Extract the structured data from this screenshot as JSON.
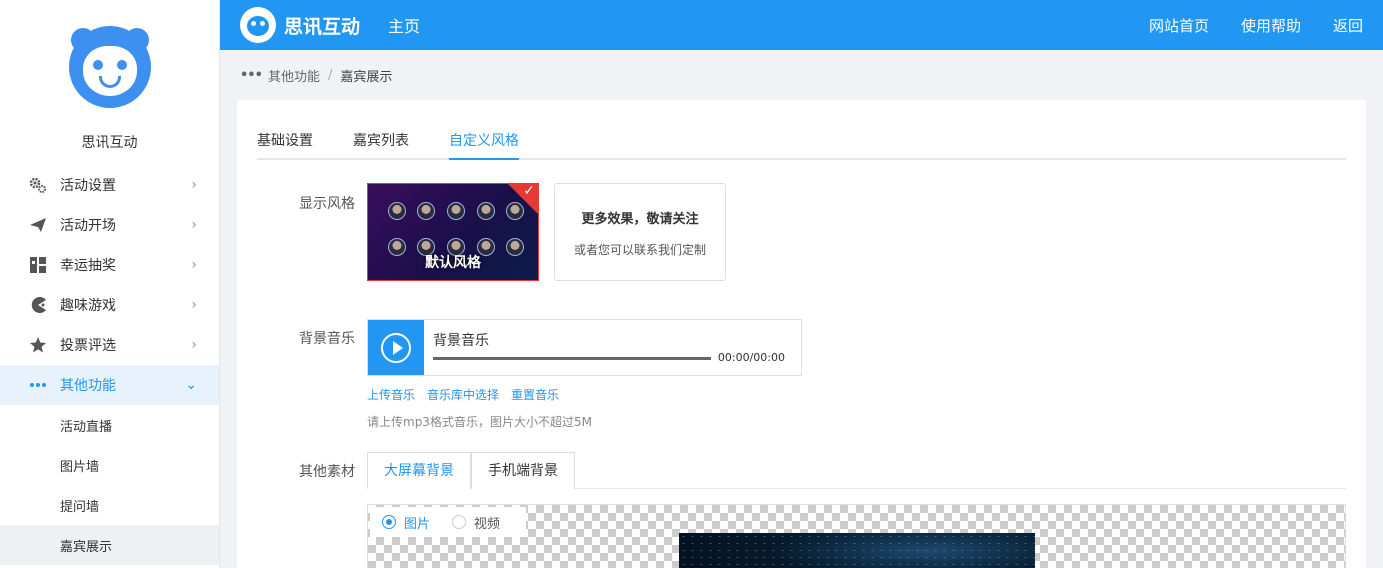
{
  "brand": {
    "name": "思讯互动"
  },
  "topbar": {
    "brand": "思讯互动",
    "home": "主页",
    "links": [
      "网站首页",
      "使用帮助",
      "返回"
    ]
  },
  "sidebar": {
    "items": [
      {
        "label": "活动设置",
        "icon": "gears-icon"
      },
      {
        "label": "活动开场",
        "icon": "paper-plane-icon"
      },
      {
        "label": "幸运抽奖",
        "icon": "grid-icon"
      },
      {
        "label": "趣味游戏",
        "icon": "pacman-icon"
      },
      {
        "label": "投票评选",
        "icon": "star-icon"
      },
      {
        "label": "其他功能",
        "icon": "more-dots-icon"
      }
    ],
    "subitems": [
      "活动直播",
      "图片墙",
      "提问墙",
      "嘉宾展示"
    ]
  },
  "breadcrumb": {
    "parent": "其他功能",
    "separator": "/",
    "current": "嘉宾展示"
  },
  "tabs": [
    "基础设置",
    "嘉宾列表",
    "自定义风格"
  ],
  "display_style": {
    "label": "显示风格",
    "default_caption": "默认风格",
    "more_title": "更多效果，敬请关注",
    "more_sub": "或者您可以联系我们定制"
  },
  "music": {
    "label": "背景音乐",
    "title": "背景音乐",
    "time": "00:00/00:00",
    "links": [
      "上传音乐",
      "音乐库中选择",
      "重置音乐"
    ],
    "tip": "请上传mp3格式音乐，图片大小不超过5M"
  },
  "materials": {
    "label": "其他素材",
    "tabs": [
      "大屏幕背景",
      "手机端背景"
    ],
    "radio_image": "图片",
    "radio_video": "视频"
  },
  "colors": {
    "accent": "#2196f3",
    "selected_border": "#e53935"
  }
}
